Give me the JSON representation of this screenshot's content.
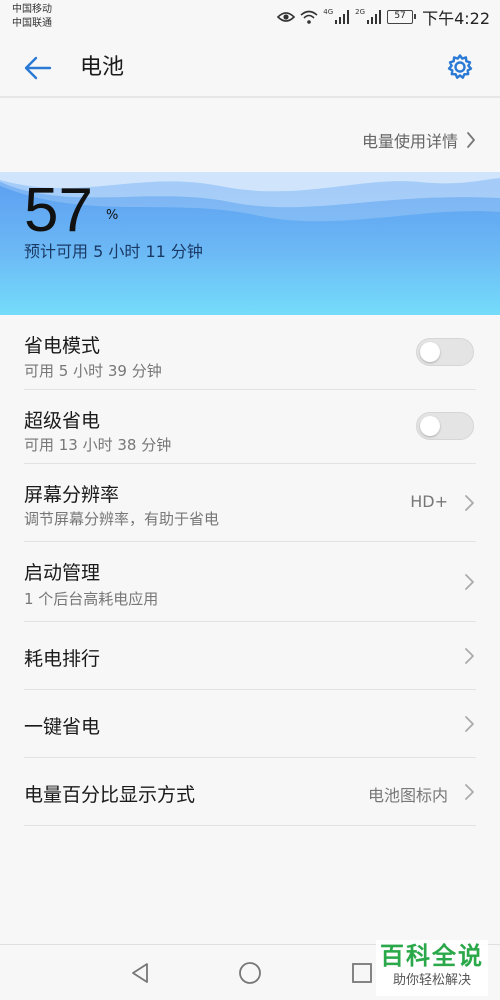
{
  "status_bar": {
    "carrier_1": "中国移动",
    "carrier_2": "中国联通",
    "net_1": "4G",
    "net_2": "2G",
    "battery_level": "57",
    "time": "下午4:22",
    "icons": [
      "eye-icon",
      "wifi-icon",
      "signal-icon",
      "signal-icon",
      "battery-icon"
    ]
  },
  "app_bar": {
    "title": "电池",
    "back_icon": "arrow-left-icon",
    "settings_icon": "gear-icon"
  },
  "usage_details": {
    "label": "电量使用详情"
  },
  "battery": {
    "percent": "57",
    "percent_sign": "%",
    "remaining": "预计可用 5 小时 11 分钟"
  },
  "settings": [
    {
      "title": "省电模式",
      "subtitle": "可用 5 小时 39 分钟",
      "control": "toggle",
      "on": false
    },
    {
      "title": "超级省电",
      "subtitle": "可用 13 小时 38 分钟",
      "control": "toggle",
      "on": false
    },
    {
      "title": "屏幕分辨率",
      "subtitle": "调节屏幕分辨率，有助于省电",
      "value": "HD+",
      "control": "chevron"
    },
    {
      "title": "启动管理",
      "subtitle": "1 个后台高耗电应用",
      "control": "chevron"
    },
    {
      "title": "耗电排行",
      "control": "chevron"
    },
    {
      "title": "一键省电",
      "control": "chevron"
    },
    {
      "title": "电量百分比显示方式",
      "value": "电池图标内",
      "control": "chevron"
    }
  ],
  "watermark": {
    "main": "百科全说",
    "sub": "助你轻松解决"
  },
  "colors": {
    "accent": "#2a7ad5",
    "hero_top": "#5a9cf0",
    "hero_bottom": "#74dcfa"
  }
}
